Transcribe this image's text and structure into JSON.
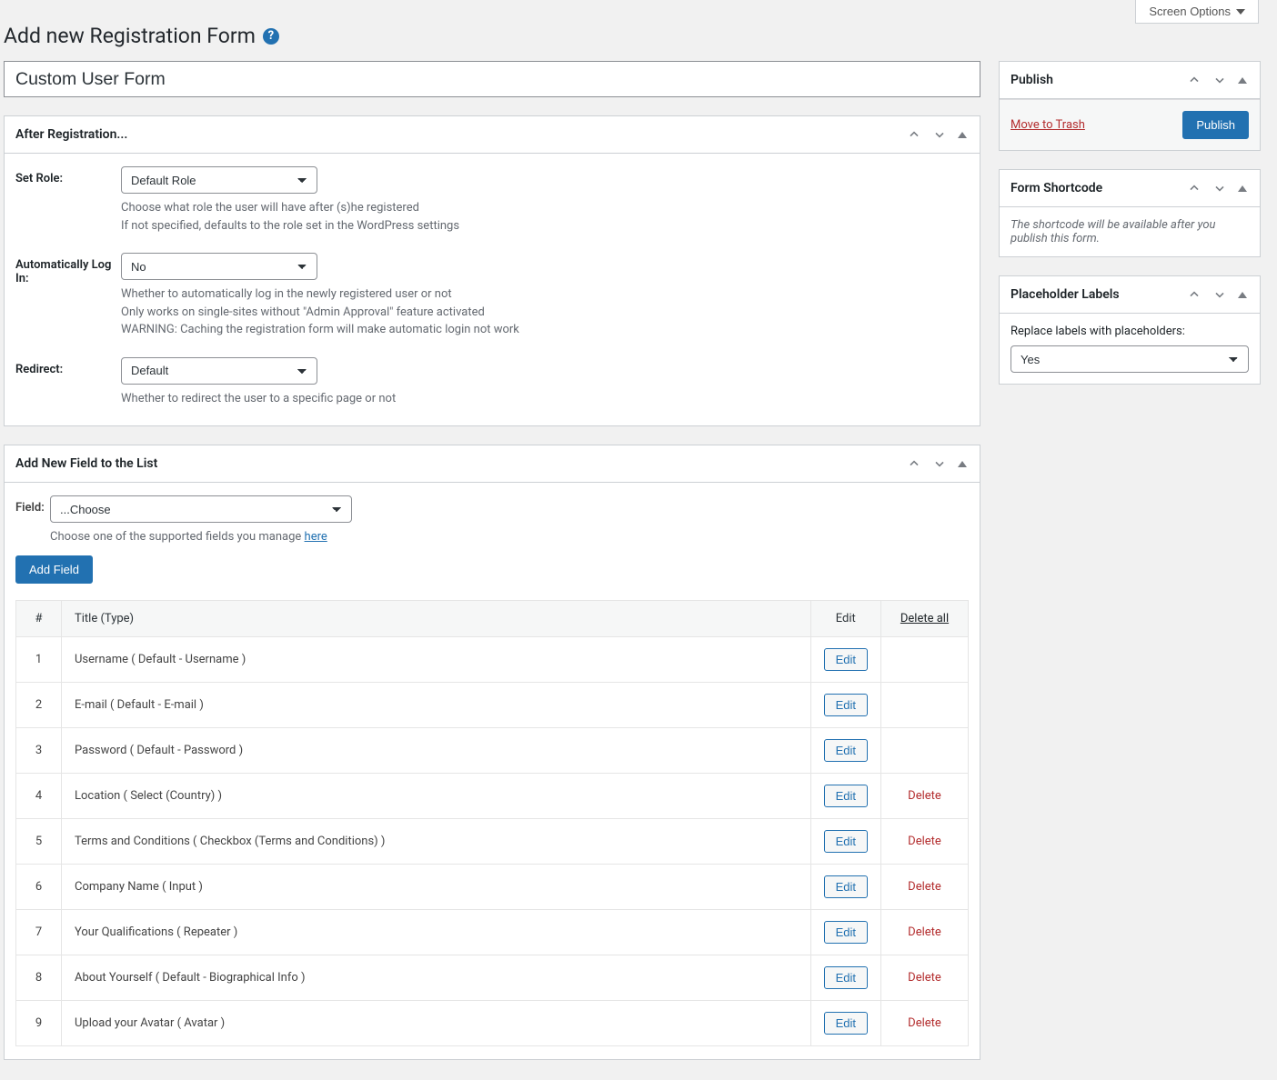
{
  "screen_options": {
    "label": "Screen Options"
  },
  "page_title": "Add new Registration Form",
  "form_title": "Custom User Form",
  "panels": {
    "after_reg": {
      "title": "After Registration...",
      "set_role": {
        "label": "Set Role:",
        "value": "Default Role",
        "desc1": "Choose what role the user will have after (s)he registered",
        "desc2": "If not specified, defaults to the role set in the WordPress settings"
      },
      "auto_login": {
        "label": "Automatically Log In:",
        "value": "No",
        "desc1": "Whether to automatically log in the newly registered user or not",
        "desc2": "Only works on single-sites without \"Admin Approval\" feature activated",
        "desc3": "WARNING: Caching the registration form will make automatic login not work"
      },
      "redirect": {
        "label": "Redirect:",
        "value": "Default",
        "desc1": "Whether to redirect the user to a specific page or not"
      }
    },
    "add_field": {
      "title": "Add New Field to the List",
      "field_label": "Field:",
      "field_value": "...Choose",
      "desc_prefix": "Choose one of the supported fields you manage ",
      "desc_link": "here",
      "add_btn": "Add Field"
    }
  },
  "table": {
    "headers": {
      "num": "#",
      "title": "Title (Type)",
      "edit": "Edit",
      "delete_all": "Delete all"
    },
    "edit_btn": "Edit",
    "delete_btn": "Delete",
    "rows": [
      {
        "n": "1",
        "title": "Username ( Default - Username )",
        "deletable": false
      },
      {
        "n": "2",
        "title": "E-mail ( Default - E-mail )",
        "deletable": false
      },
      {
        "n": "3",
        "title": "Password ( Default - Password )",
        "deletable": false
      },
      {
        "n": "4",
        "title": "Location ( Select (Country) )",
        "deletable": true
      },
      {
        "n": "5",
        "title": "Terms and Conditions ( Checkbox (Terms and Conditions) )",
        "deletable": true
      },
      {
        "n": "6",
        "title": "Company Name ( Input )",
        "deletable": true
      },
      {
        "n": "7",
        "title": "Your Qualifications ( Repeater )",
        "deletable": true
      },
      {
        "n": "8",
        "title": "About Yourself ( Default - Biographical Info )",
        "deletable": true
      },
      {
        "n": "9",
        "title": "Upload your Avatar ( Avatar )",
        "deletable": true
      }
    ]
  },
  "sidebar": {
    "publish": {
      "title": "Publish",
      "trash": "Move to Trash",
      "button": "Publish"
    },
    "shortcode": {
      "title": "Form Shortcode",
      "desc": "The shortcode will be available after you publish this form."
    },
    "placeholder": {
      "title": "Placeholder Labels",
      "label": "Replace labels with placeholders:",
      "value": "Yes"
    }
  }
}
